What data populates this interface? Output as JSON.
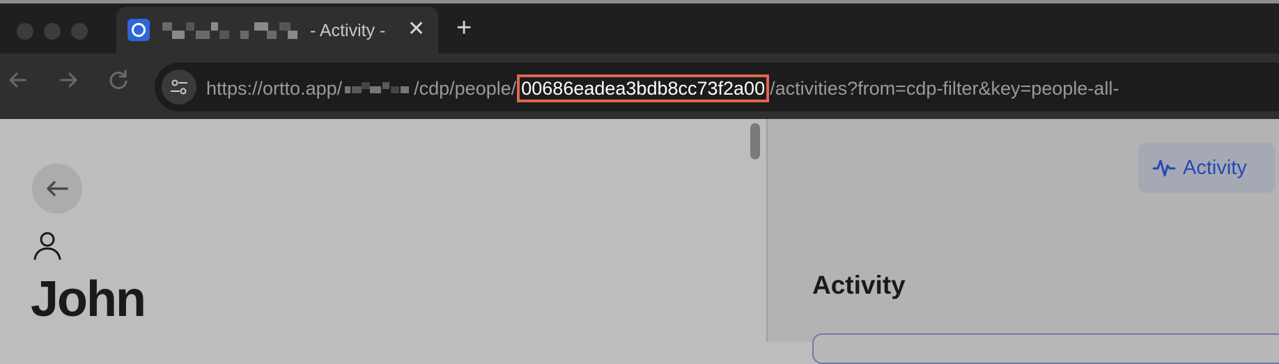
{
  "browser": {
    "tab": {
      "title_suffix": "- Activity -",
      "close_glyph": "✕",
      "favicon": "ortto-logo-icon"
    },
    "new_tab_glyph": "+",
    "nav": {
      "back": "arrow-left-icon",
      "forward": "arrow-right-icon",
      "reload": "reload-icon"
    },
    "omnibox": {
      "icon": "site-settings-icon",
      "url_prefix": "https://ortto.app/",
      "url_middle": "/cdp/people/",
      "url_highlight": "00686eadea3bdb8cc73f2a00",
      "url_suffix": "/activities?from=cdp-filter&key=people-all-",
      "highlight_color": "#e0664f"
    }
  },
  "left_pane": {
    "back_icon": "arrow-left-icon",
    "person_icon": "person-icon",
    "name": "John"
  },
  "right_pane": {
    "activity_button": {
      "label": "Activity",
      "icon": "activity-pulse-icon",
      "color": "#2648b8"
    },
    "heading": "Activity"
  }
}
